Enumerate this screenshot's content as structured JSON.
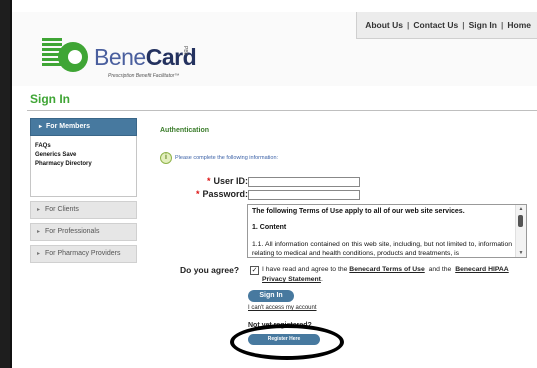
{
  "topnav": {
    "items": [
      "About Us",
      "Contact Us",
      "Sign In",
      "Home"
    ],
    "separator": "|"
  },
  "brand": {
    "name_light": "Bene",
    "name_bold": "Card",
    "superscript": "PBF",
    "tagline": "Prescription Benefit Facilitator™"
  },
  "page": {
    "title": "Sign In"
  },
  "sidebar": {
    "active_section": "For Members",
    "member_links": [
      "FAQs",
      "Generics Save",
      "Pharmacy Directory"
    ],
    "sections": [
      "For Clients",
      "For Professionals",
      "For Pharmacy Providers"
    ]
  },
  "auth": {
    "title": "Authentication",
    "info": "Please complete the following information:",
    "user_id_label": "User ID:",
    "password_label": "Password:",
    "user_id_value": "",
    "password_value": ""
  },
  "terms": {
    "line1": "The following Terms of Use apply to all of our web site services.",
    "line2": "1. Content",
    "line3": "1.1. All information contained on this web site, including, but not limited to, information relating to medical and health conditions, products and treatments, is"
  },
  "agreement": {
    "question": "Do you agree?",
    "checked": true,
    "text_prefix": "I have read and agree to the",
    "terms_link": "Benecard Terms of Use",
    "and": "and the",
    "privacy_link": "Benecard HIPAA Privacy Statement",
    "suffix": "."
  },
  "actions": {
    "signin": "Sign In",
    "cant_access": "I can't access my account",
    "not_registered": "Not yet registered?",
    "register": "Register Here"
  },
  "colors": {
    "brand_green": "#3fa535",
    "brand_navy": "#24325f",
    "button_blue": "#47799f"
  }
}
